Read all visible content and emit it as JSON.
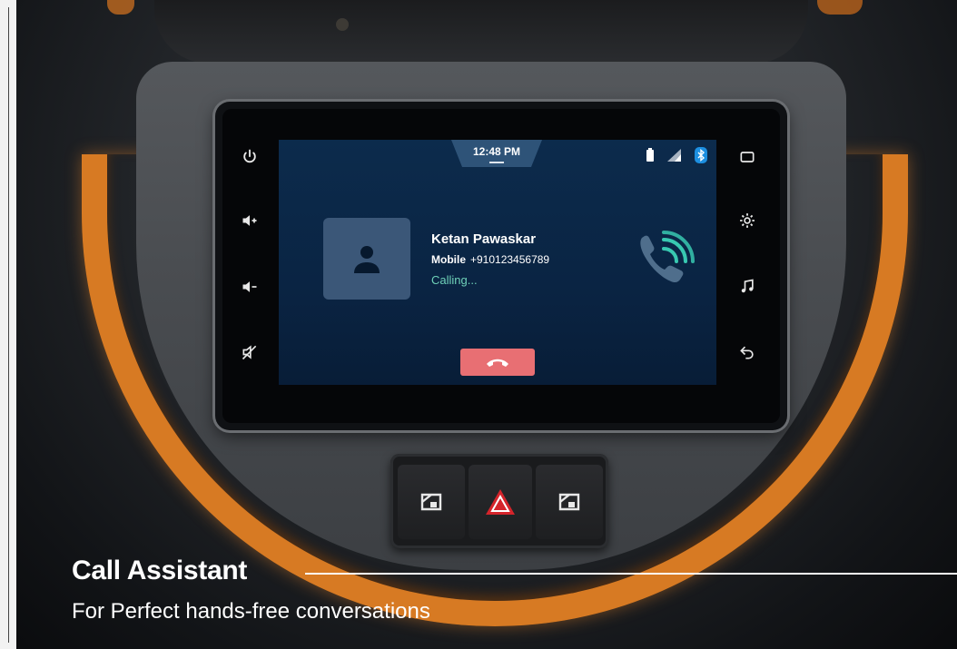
{
  "screen": {
    "time": "12:48 PM",
    "contact_name": "Ketan Pawaskar",
    "phone_type": "Mobile",
    "phone_number": "+910123456789",
    "call_status": "Calling...",
    "colors": {
      "screen_bg": "#0a2443",
      "calling_text": "#6fd1b8",
      "end_call": "#e86f73",
      "call_icon": "#38c9b1"
    }
  },
  "head_unit": {
    "left_buttons": [
      "power-icon",
      "volume-up-icon",
      "volume-down-icon",
      "mute-icon"
    ],
    "right_buttons": [
      "screen-icon",
      "settings-icon",
      "music-icon",
      "back-icon"
    ]
  },
  "caption": {
    "title": "Call Assistant",
    "subtitle": "For Perfect hands-free conversations"
  },
  "colors": {
    "accent_orange": "#d77a23"
  }
}
